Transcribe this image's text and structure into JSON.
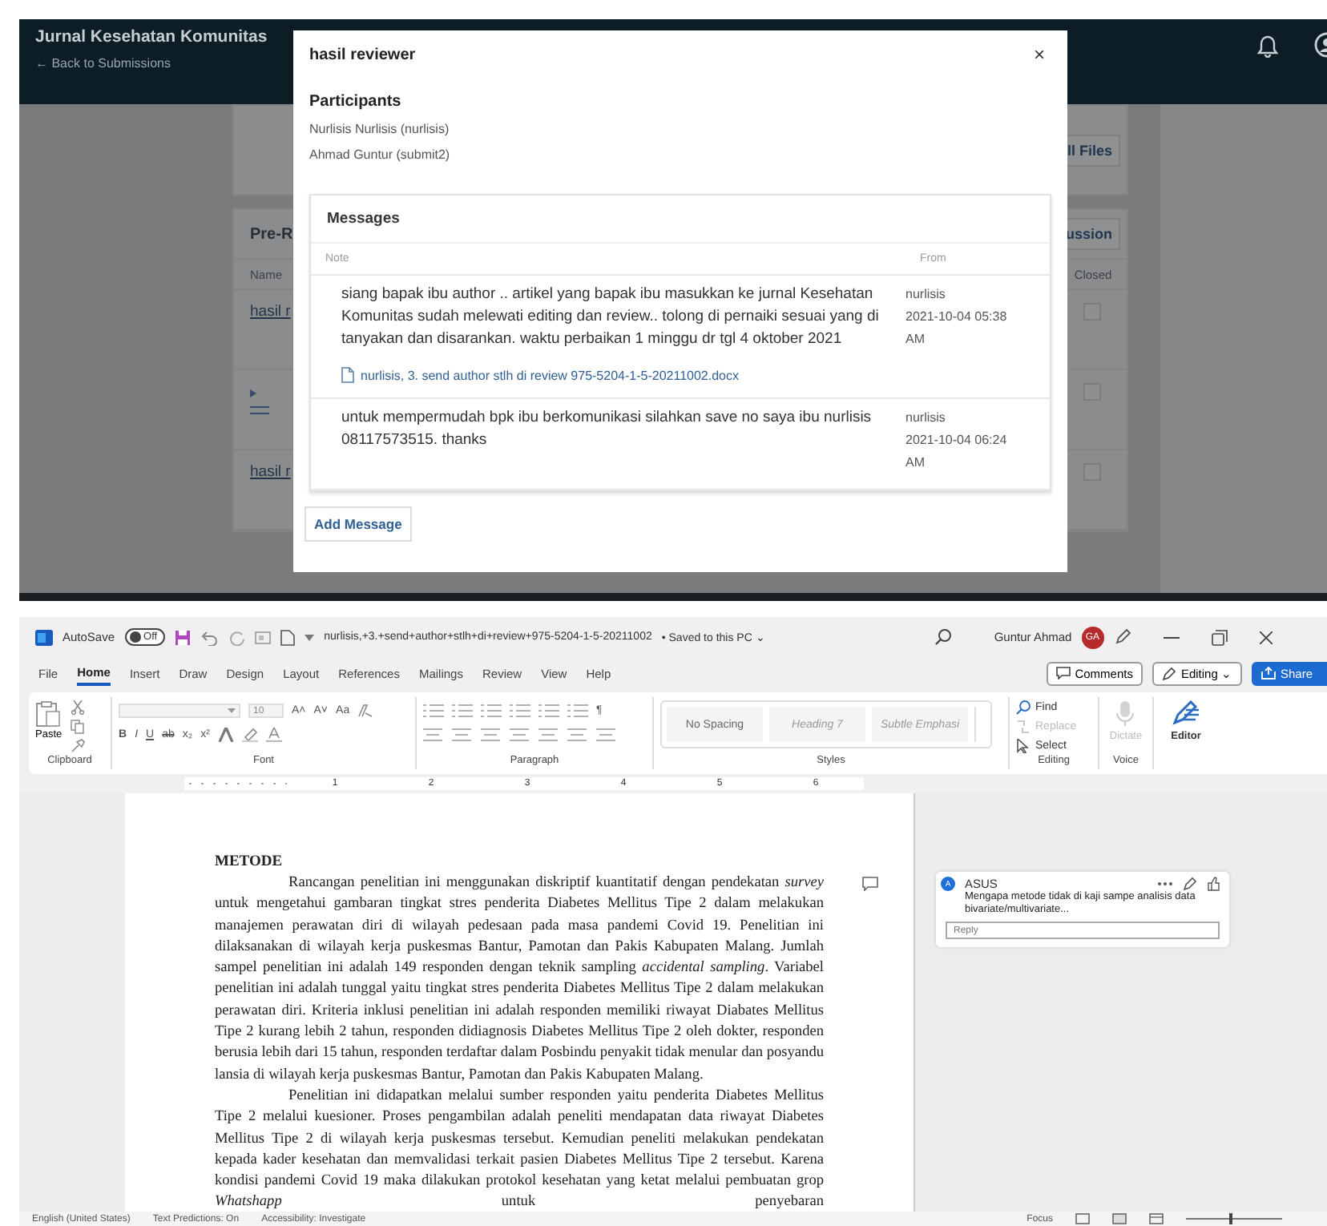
{
  "ojs": {
    "journal_title": "Jurnal Kesehatan Komunitas",
    "back_link": "← Back to Submissions",
    "files_button": "ll Files",
    "section_title": "Pre-R",
    "discussion_button": "ussion",
    "columns": [
      "Name",
      "Closed"
    ],
    "rows": [
      {
        "kind": "link",
        "name": "hasil r",
        "closed": false
      },
      {
        "kind": "handle",
        "closed": false
      },
      {
        "kind": "link",
        "name": "hasil r",
        "closed": false
      }
    ]
  },
  "modal": {
    "title": "hasil reviewer",
    "close": "×",
    "participants_heading": "Participants",
    "participants": [
      "Nurlisis Nurlisis (nurlisis)",
      "Ahmad Guntur (submit2)"
    ],
    "messages_heading": "Messages",
    "columns": [
      "Note",
      "From"
    ],
    "messages": [
      {
        "text": "siang bapak ibu author .. artikel yang bapak ibu masukkan ke jurnal Kesehatan Komunitas sudah melewati editing dan review.. tolong di pernaiki sesuai yang di tanyakan dan disarankan. waktu perbaikan 1 minggu dr tgl 4 oktober 2021",
        "author": "nurlisis",
        "date": "2021-10-04 05:38 AM",
        "attachment": "nurlisis, 3. send author stlh di review 975-5204-1-5-20211002.docx"
      },
      {
        "text": "untuk mempermudah bpk ibu berkomunikasi silahkan save no saya ibu nurlisis 08117573515. thanks",
        "author": "nurlisis",
        "date": "2021-10-04 06:24 AM"
      }
    ],
    "add_button": "Add Message"
  },
  "word": {
    "title_bar": {
      "autosave_label": "AutoSave",
      "autosave": {
        "label": "Off",
        "on": false
      },
      "filename": "nurlisis,+3.+send+author+stlh+di+review+975-5204-1-5-20211002",
      "save_status": "• Saved to this PC ⌄",
      "user_name": "Guntur Ahmad",
      "user_initials": "GA"
    },
    "tabs": [
      {
        "label": "File",
        "selected": false
      },
      {
        "label": "Home",
        "selected": true
      },
      {
        "label": "Insert",
        "selected": false
      },
      {
        "label": "Draw",
        "selected": false
      },
      {
        "label": "Design",
        "selected": false
      },
      {
        "label": "Layout",
        "selected": false
      },
      {
        "label": "References",
        "selected": false
      },
      {
        "label": "Mailings",
        "selected": false
      },
      {
        "label": "Review",
        "selected": false
      },
      {
        "label": "View",
        "selected": false
      },
      {
        "label": "Help",
        "selected": false
      }
    ],
    "comments_button": "Comments",
    "editing_button": "Editing ⌄",
    "share_button": "Share",
    "ribbon": {
      "paste": "Paste",
      "font_size": "10",
      "font_top": [
        "A˄",
        "A˅",
        "Aa"
      ],
      "font_bottom": [
        "B",
        "I",
        "U",
        "ab",
        "x₂",
        "x²"
      ],
      "pilcrow": "¶",
      "styles": [
        {
          "label": "No Spacing",
          "kind": "normal"
        },
        {
          "label": "Heading 7",
          "kind": "emphasis"
        },
        {
          "label": "Subtle Emphasi",
          "kind": "emphasis"
        }
      ],
      "editing": [
        {
          "label": "Find",
          "kind": "find",
          "disabled": false
        },
        {
          "label": "Replace",
          "kind": "replace",
          "disabled": true
        },
        {
          "label": "Select",
          "kind": "select",
          "disabled": false
        }
      ],
      "dictate": {
        "label": "Dictate",
        "disabled": true
      },
      "editor": "Editor",
      "groups": [
        "Clipboard",
        "Font",
        "Paragraph",
        "Styles",
        "Editing",
        "Voice"
      ]
    },
    "ruler": [
      "1",
      "2",
      "3",
      "4",
      "5",
      "6"
    ],
    "document": {
      "heading": "METODE",
      "paragraphs": [
        "Rancangan penelitian ini menggunakan diskriptif kuantitatif dengan pendekatan *survey* untuk mengetahui gambaran tingkat stres penderita Diabetes Mellitus Tipe 2 dalam melakukan manajemen perawatan diri di wilayah pedesaan pada masa pandemi Covid 19. Penelitian ini dilaksanakan di wilayah kerja puskesmas Bantur, Pamotan dan Pakis Kabupaten Malang. Jumlah sampel penelitian ini adalah 149 responden dengan teknik sampling *accidental sampling*. Variabel penelitian ini adalah tunggal yaitu tingkat stres penderita Diabetes Mellitus Tipe 2 dalam melakukan perawatan diri. Kriteria inklusi penelitian ini adalah responden memiliki riwayat Diabates Mellitus Tipe 2 kurang lebih 2 tahun, responden didiagnosis Diabetes  Mellitus Tipe 2 oleh dokter, responden berusia lebih dari 15 tahun, responden terdaftar dalam Posbindu penyakit tidak menular dan posyandu lansia di wilayah kerja puskesmas Bantur, Pamotan dan Pakis Kabupaten Malang.",
        "Penelitian ini didapatkan melalui sumber responden yaitu penderita Diabetes Mellitus Tipe 2 melalui kuesioner. Proses pengambilan adalah peneliti mendapatan data riwayat Diabetes Mellitus Tipe 2 di wilayah kerja puskesmas tersebut. Kemudian peneliti melakukan pendekatan kepada kader kesehatan dan memvalidasi terkait pasien Diabetes  Mellitus Tipe 2 tersebut. Karena kondisi pandemi Covid 19 maka dilakukan protokol kesehatan yang ketat melalui pembuatan grop *Whatshapp* untuk penyebaran"
      ]
    },
    "comment": {
      "initial": "A",
      "author": "ASUS",
      "text": "Mengapa metode  tidak di kaji sampe analisis data bivariate/multivariate...",
      "reply_placeholder": "Reply"
    },
    "status_bar": {
      "left": [
        "English (United States)",
        "Text Predictions: On",
        "Accessibility: Investigate"
      ],
      "focus": "Focus",
      "zoom": {
        "level": 0.45
      }
    }
  }
}
